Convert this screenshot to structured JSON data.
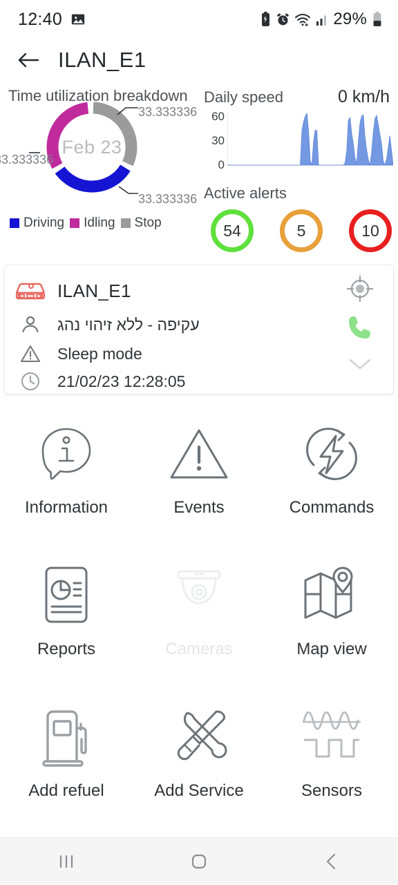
{
  "status_bar": {
    "time": "12:40",
    "battery_percent": "29%",
    "icons": [
      "image-icon",
      "battery-saver-icon",
      "alarm-icon",
      "wifi-icon",
      "signal-icon",
      "battery-icon"
    ]
  },
  "app_bar": {
    "back_label": "back-arrow",
    "title": "ILAN_E1"
  },
  "time_utilization": {
    "title": "Time utilization breakdown",
    "center_label": "Feb 23",
    "labels": [
      "33.333336",
      "33.333336",
      "33.333336"
    ],
    "legend": [
      {
        "label": "Driving",
        "color": "#1414d2"
      },
      {
        "label": "Idling",
        "color": "#bf2b9c"
      },
      {
        "label": "Stop",
        "color": "#9b9b9b"
      }
    ]
  },
  "daily_speed": {
    "title": "Daily speed",
    "value": "0 km/h",
    "y_ticks": [
      "60",
      "30",
      "0"
    ]
  },
  "active_alerts": {
    "title": "Active alerts",
    "items": [
      {
        "count": "54",
        "color": "#5fe03c"
      },
      {
        "count": "5",
        "color": "#e8a03a"
      },
      {
        "count": "10",
        "color": "#e81f1f"
      }
    ]
  },
  "vehicle_card": {
    "name": "ILAN_E1",
    "driver": "עקיפה - ללא זיהוי נהג",
    "status": "Sleep mode",
    "timestamp": "21/02/23 12:28:05",
    "actions": [
      "locate-icon",
      "call-icon",
      "expand-icon"
    ]
  },
  "actions_grid": [
    [
      {
        "label": "Information",
        "icon": "information-icon",
        "enabled": true
      },
      {
        "label": "Events",
        "icon": "events-warning-icon",
        "enabled": true
      },
      {
        "label": "Commands",
        "icon": "commands-lightning-icon",
        "enabled": true
      }
    ],
    [
      {
        "label": "Reports",
        "icon": "reports-icon",
        "enabled": true
      },
      {
        "label": "Cameras",
        "icon": "camera-icon",
        "enabled": false
      },
      {
        "label": "Map view",
        "icon": "map-view-icon",
        "enabled": true
      }
    ],
    [
      {
        "label": "Add refuel",
        "icon": "fuel-pump-icon",
        "enabled": true
      },
      {
        "label": "Add Service",
        "icon": "service-tools-icon",
        "enabled": true
      },
      {
        "label": "Sensors",
        "icon": "sensors-wave-icon",
        "enabled": true
      }
    ]
  ],
  "nav_bar": {
    "recents": "recents-icon",
    "home": "home-icon",
    "back": "back-icon"
  },
  "chart_data": [
    {
      "type": "pie",
      "title": "Time utilization breakdown",
      "center_label": "Feb 23",
      "categories": [
        "Stop",
        "Driving",
        "Idling"
      ],
      "values": [
        33.333336,
        33.333336,
        33.333336
      ],
      "colors": [
        "#9b9b9b",
        "#1414d2",
        "#bf2b9c"
      ],
      "legend_position": "bottom",
      "grid": false
    },
    {
      "type": "line",
      "title": "Daily speed",
      "ylabel": "",
      "xlabel": "",
      "ylim": [
        0,
        75
      ],
      "y_ticks": [
        0,
        30,
        60
      ],
      "grid": false,
      "series": [
        {
          "name": "speed",
          "x": [
            0,
            30,
            40,
            44,
            45,
            46,
            47,
            48,
            49,
            50,
            51,
            52,
            53,
            54,
            55,
            56,
            57,
            58,
            59,
            60,
            61,
            62,
            63,
            64,
            65,
            66,
            67,
            68,
            69,
            70,
            71,
            72,
            73,
            74,
            75,
            76,
            77,
            78,
            79,
            80,
            81,
            82,
            83,
            84,
            85,
            86,
            87,
            88,
            89,
            90,
            91,
            92,
            93,
            94,
            95,
            96,
            97,
            98,
            100
          ],
          "values": [
            0,
            0,
            0,
            0,
            50,
            62,
            70,
            74,
            48,
            6,
            0,
            34,
            50,
            49,
            0,
            0,
            0,
            0,
            0,
            0,
            0,
            0,
            0,
            0,
            0,
            0,
            0,
            0,
            0,
            0,
            3,
            20,
            64,
            68,
            45,
            30,
            10,
            2,
            34,
            60,
            70,
            72,
            40,
            22,
            8,
            0,
            18,
            46,
            66,
            71,
            58,
            44,
            30,
            6,
            0,
            8,
            24,
            42,
            0
          ]
        }
      ]
    }
  ]
}
